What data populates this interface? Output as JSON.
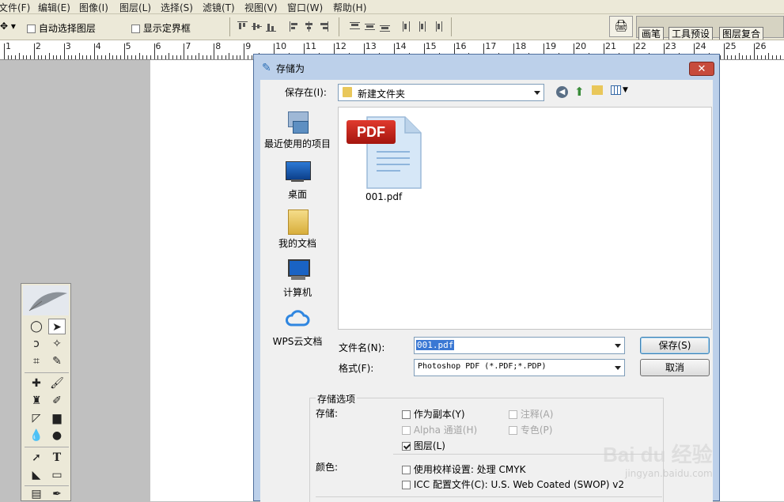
{
  "menubar": {
    "items": [
      "文件(F)",
      "编辑(E)",
      "图像(I)",
      "图层(L)",
      "选择(S)",
      "滤镜(T)",
      "视图(V)",
      "窗口(W)",
      "帮助(H)"
    ]
  },
  "options": {
    "auto_select": "自动选择图层",
    "show_bounds": "显示定界框",
    "palette_tabs": [
      "画笔",
      "工具预设",
      "图层复合"
    ]
  },
  "ruler": {
    "labels": [
      "1",
      "2",
      "3",
      "4",
      "5",
      "6",
      "7",
      "8",
      "9",
      "10",
      "11",
      "12",
      "13",
      "14",
      "15",
      "16",
      "17",
      "18",
      "19",
      "20",
      "21",
      "22",
      "23",
      "24",
      "25",
      "26",
      "2"
    ]
  },
  "dialog": {
    "title": "存储为",
    "close": "✕",
    "save_in_label": "保存在(I):",
    "save_in_value": "新建文件夹",
    "places": [
      "最近使用的项目",
      "桌面",
      "我的文档",
      "计算机",
      "WPS云文档"
    ],
    "file": {
      "name": "001.pdf",
      "badge": "PDF"
    },
    "filename_label": "文件名(N):",
    "filename_value": "001.pdf",
    "format_label": "格式(F):",
    "format_value": "Photoshop PDF (*.PDF;*.PDP)",
    "save_button": "保存(S)",
    "cancel_button": "取消",
    "save_options": {
      "title": "存储选项",
      "store_label": "存储:",
      "as_copy": "作为副本(Y)",
      "annotations": "注释(A)",
      "alpha": "Alpha 通道(H)",
      "spot": "专色(P)",
      "layers": "图层(L)",
      "color_label": "颜色:",
      "proof": "使用校样设置: 处理 CMYK",
      "icc": "ICC 配置文件(C): U.S. Web Coated (SWOP) v2"
    }
  },
  "watermark": {
    "brand": "Bai du 经验",
    "url": "jingyan.baidu.com"
  }
}
